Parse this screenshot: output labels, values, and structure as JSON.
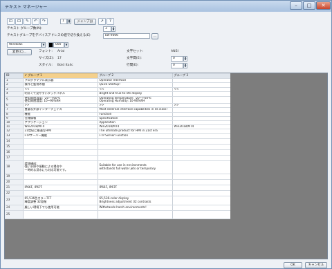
{
  "window": {
    "title": "テキスト マネージャー",
    "min": "–",
    "max": "□",
    "close": "✕"
  },
  "toolbar": {
    "buttons": [
      "⊡",
      "⊡",
      "✎",
      "↶",
      "↷"
    ],
    "jump_value": "1",
    "jump_label": "ジャンプ(J)",
    "extra_buttons": [
      "↗",
      "?"
    ]
  },
  "group_count": {
    "label": "テキスト グループ数(N):",
    "value": "3"
  },
  "switch_group": {
    "label": "テキストグループをデバイスアドレスの値で切り換える(E)",
    "value": "LW-9006",
    "browse": "..."
  },
  "style_row": {
    "window_select": "Windows",
    "color_value": "000"
  },
  "font_panel": {
    "change_button": "変更(C)...",
    "font_label": "フォント:",
    "font_value": "Arial",
    "size_label": "サイズ(Z):",
    "size_value": "17",
    "style_label": "スタイル:",
    "style_value": "Bold Italic",
    "charset_label": "文字セット:",
    "charset_value": "ANSI",
    "spacing_label": "文字間(E):",
    "spacing_value": "0",
    "line_label": "行間(E):",
    "line_value": "0"
  },
  "grid": {
    "columns": [
      "ID",
      "✔ グループ 1",
      "グループ 2",
      "グループ 3"
    ],
    "rows": [
      {
        "id": "1",
        "g1": "プログラマブル表示器",
        "g2": "Operator Interface",
        "g3": ""
      },
      {
        "id": "2",
        "g1": "操作と監視の間",
        "g2": "Quick Startup!",
        "g3": ""
      },
      {
        "id": "3",
        "g1": "<<",
        "g2": "<<",
        "g3": "<<"
      },
      {
        "id": "4",
        "g1": "明るくて見やすいタッチパネル",
        "g2": "Bright and true-to-life display",
        "g3": ""
      },
      {
        "id": "5",
        "g1": "使用周囲温度: -20~+60℃\n使用周囲湿度: 10~90%RH",
        "g2": "Operating temperature: -20~+60℃\nOperating Humidity: 10-90%RH",
        "g3": ""
      },
      {
        "id": "6",
        "g1": ">>",
        "g2": ">>",
        "g3": ">>"
      },
      {
        "id": "7",
        "g1": "豊富な外部インターフェイス",
        "g2": "Most external interface capabilities in its class!",
        "g3": ""
      },
      {
        "id": "8",
        "g1": "機能",
        "g2": "Function",
        "g3": ""
      },
      {
        "id": "9",
        "g1": "仕様情報",
        "g2": "Specification",
        "g3": ""
      },
      {
        "id": "10",
        "g1": "アプリケーション",
        "g2": "Application",
        "g3": ""
      },
      {
        "id": "11",
        "g1": "Win2018/MT4",
        "g2": "Win2018/MT4",
        "g3": "Win2018/MT4"
      },
      {
        "id": "12",
        "g1": "21世紀に最適なHMI",
        "g2": "The ultimate product for HMI in 21st era",
        "g3": ""
      },
      {
        "id": "13",
        "g1": "FTPサーバー機能",
        "g2": "FTP Server Function",
        "g3": ""
      },
      {
        "id": "14",
        "g1": "",
        "g2": "",
        "g3": ""
      },
      {
        "id": "15",
        "g1": "",
        "g2": "",
        "g3": ""
      },
      {
        "id": "16",
        "g1": "",
        "g2": "",
        "g3": ""
      },
      {
        "id": "17",
        "g1": "",
        "g2": "",
        "g3": ""
      },
      {
        "id": "18",
        "g1": "環境構成:\n強い水掛や振動による場合や\n一時的な浸水にも対応可能です。",
        "g2": "Suitable for use in environments\nwithstands full water jets or temporary",
        "g3": ""
      },
      {
        "id": "19",
        "g1": "",
        "g2": "",
        "g3": ""
      },
      {
        "id": "20",
        "g1": "",
        "g2": "",
        "g3": ""
      },
      {
        "id": "21",
        "g1": "IP66F, IP67F",
        "g2": "IP66F, IP67F",
        "g3": ""
      },
      {
        "id": "22",
        "g1": "",
        "g2": "",
        "g3": ""
      },
      {
        "id": "23",
        "g1": "65,536色カラーTFT\n輝度調整 32段階",
        "g2": "65,536-color display\nBrightness adjustment 32 contrasts",
        "g3": ""
      },
      {
        "id": "24",
        "g1": "厳しい環境下でも使用可能",
        "g2": "Withstands harsh environments!",
        "g3": ""
      },
      {
        "id": "25",
        "g1": "",
        "g2": "",
        "g3": ""
      }
    ]
  },
  "footer": {
    "ok": "OK",
    "cancel": "キャンセル"
  }
}
